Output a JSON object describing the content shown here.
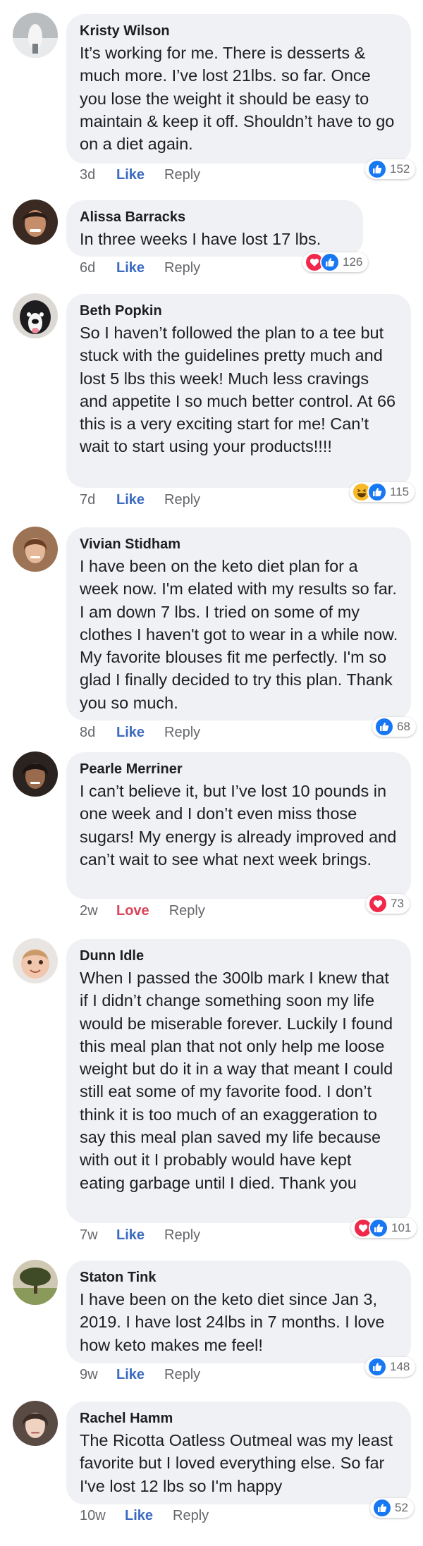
{
  "comments": [
    {
      "author": "Kristy Wilson",
      "text": "It’s working for me. There is desserts & much more. I’ve lost 21lbs. so far. Once you lose the weight it should be easy to maintain & keep it off. Shouldn’t have to go on a diet again.",
      "time": "3d",
      "action": "Like",
      "reply": "Reply",
      "reactions": [
        "like"
      ],
      "count": "152"
    },
    {
      "author": "Alissa Barracks",
      "text": "In three weeks I have lost 17 lbs.",
      "time": "6d",
      "action": "Like",
      "reply": "Reply",
      "reactions": [
        "love",
        "like"
      ],
      "count": "126"
    },
    {
      "author": "Beth Popkin",
      "text": "So I haven’t followed the plan to a tee but stuck with the guidelines pretty much and lost 5 lbs this week! Much less cravings and appetite I so much better control. At 66 this is a very exciting start for me! Can’t wait to start using your products!!!!",
      "time": "7d",
      "action": "Like",
      "reply": "Reply",
      "reactions": [
        "haha",
        "like"
      ],
      "count": "115"
    },
    {
      "author": "Vivian Stidham",
      "text": "I have been on the keto diet plan for a week now. I'm elated with my results so far. I am down 7 lbs. I tried on some of my clothes I haven't got to wear in a while now. My favorite blouses fit me perfectly. I'm so glad I finally decided to try this plan. Thank you so much.",
      "time": "8d",
      "action": "Like",
      "reply": "Reply",
      "reactions": [
        "like"
      ],
      "count": "68"
    },
    {
      "author": "Pearle Merriner",
      "text": "I can’t believe it, but I’ve lost 10 pounds in one week and I don’t even miss those sugars! My energy is already improved and can’t wait to see what next week brings.",
      "time": "2w",
      "action": "Love",
      "reply": "Reply",
      "reactions": [
        "love"
      ],
      "count": "73"
    },
    {
      "author": "Dunn Idle",
      "text": "When I passed the 300lb mark I knew that if I didn’t change something soon my life would be miserable forever. Luckily I found this meal plan that not only help me loose weight but do it in a way that meant I could still eat some of my favorite food. I don’t think it is too much of an exaggeration to say this meal plan saved my life because with out it I probably would have kept eating garbage until I died. Thank you",
      "time": "7w",
      "action": "Like",
      "reply": "Reply",
      "reactions": [
        "love",
        "like"
      ],
      "count": "101"
    },
    {
      "author": "Staton Tink",
      "text": "I have been on the keto diet since Jan 3, 2019. I have lost 24lbs in 7 months. I love how keto makes me feel!",
      "time": "9w",
      "action": "Like",
      "reply": "Reply",
      "reactions": [
        "like"
      ],
      "count": "148"
    },
    {
      "author": "Rachel Hamm",
      "text": "The Ricotta Oatless Outmeal was my least favorite but I loved everything else. So far I've lost 12 lbs so I'm happy",
      "time": "10w",
      "action": "Like",
      "reply": "Reply",
      "reactions": [
        "like"
      ],
      "count": "52"
    }
  ],
  "colors": {
    "bubble": "#f0f1f4",
    "like_blue": "#3b6ac0",
    "love_red": "#d9435a",
    "meta_gray": "#65676b"
  }
}
